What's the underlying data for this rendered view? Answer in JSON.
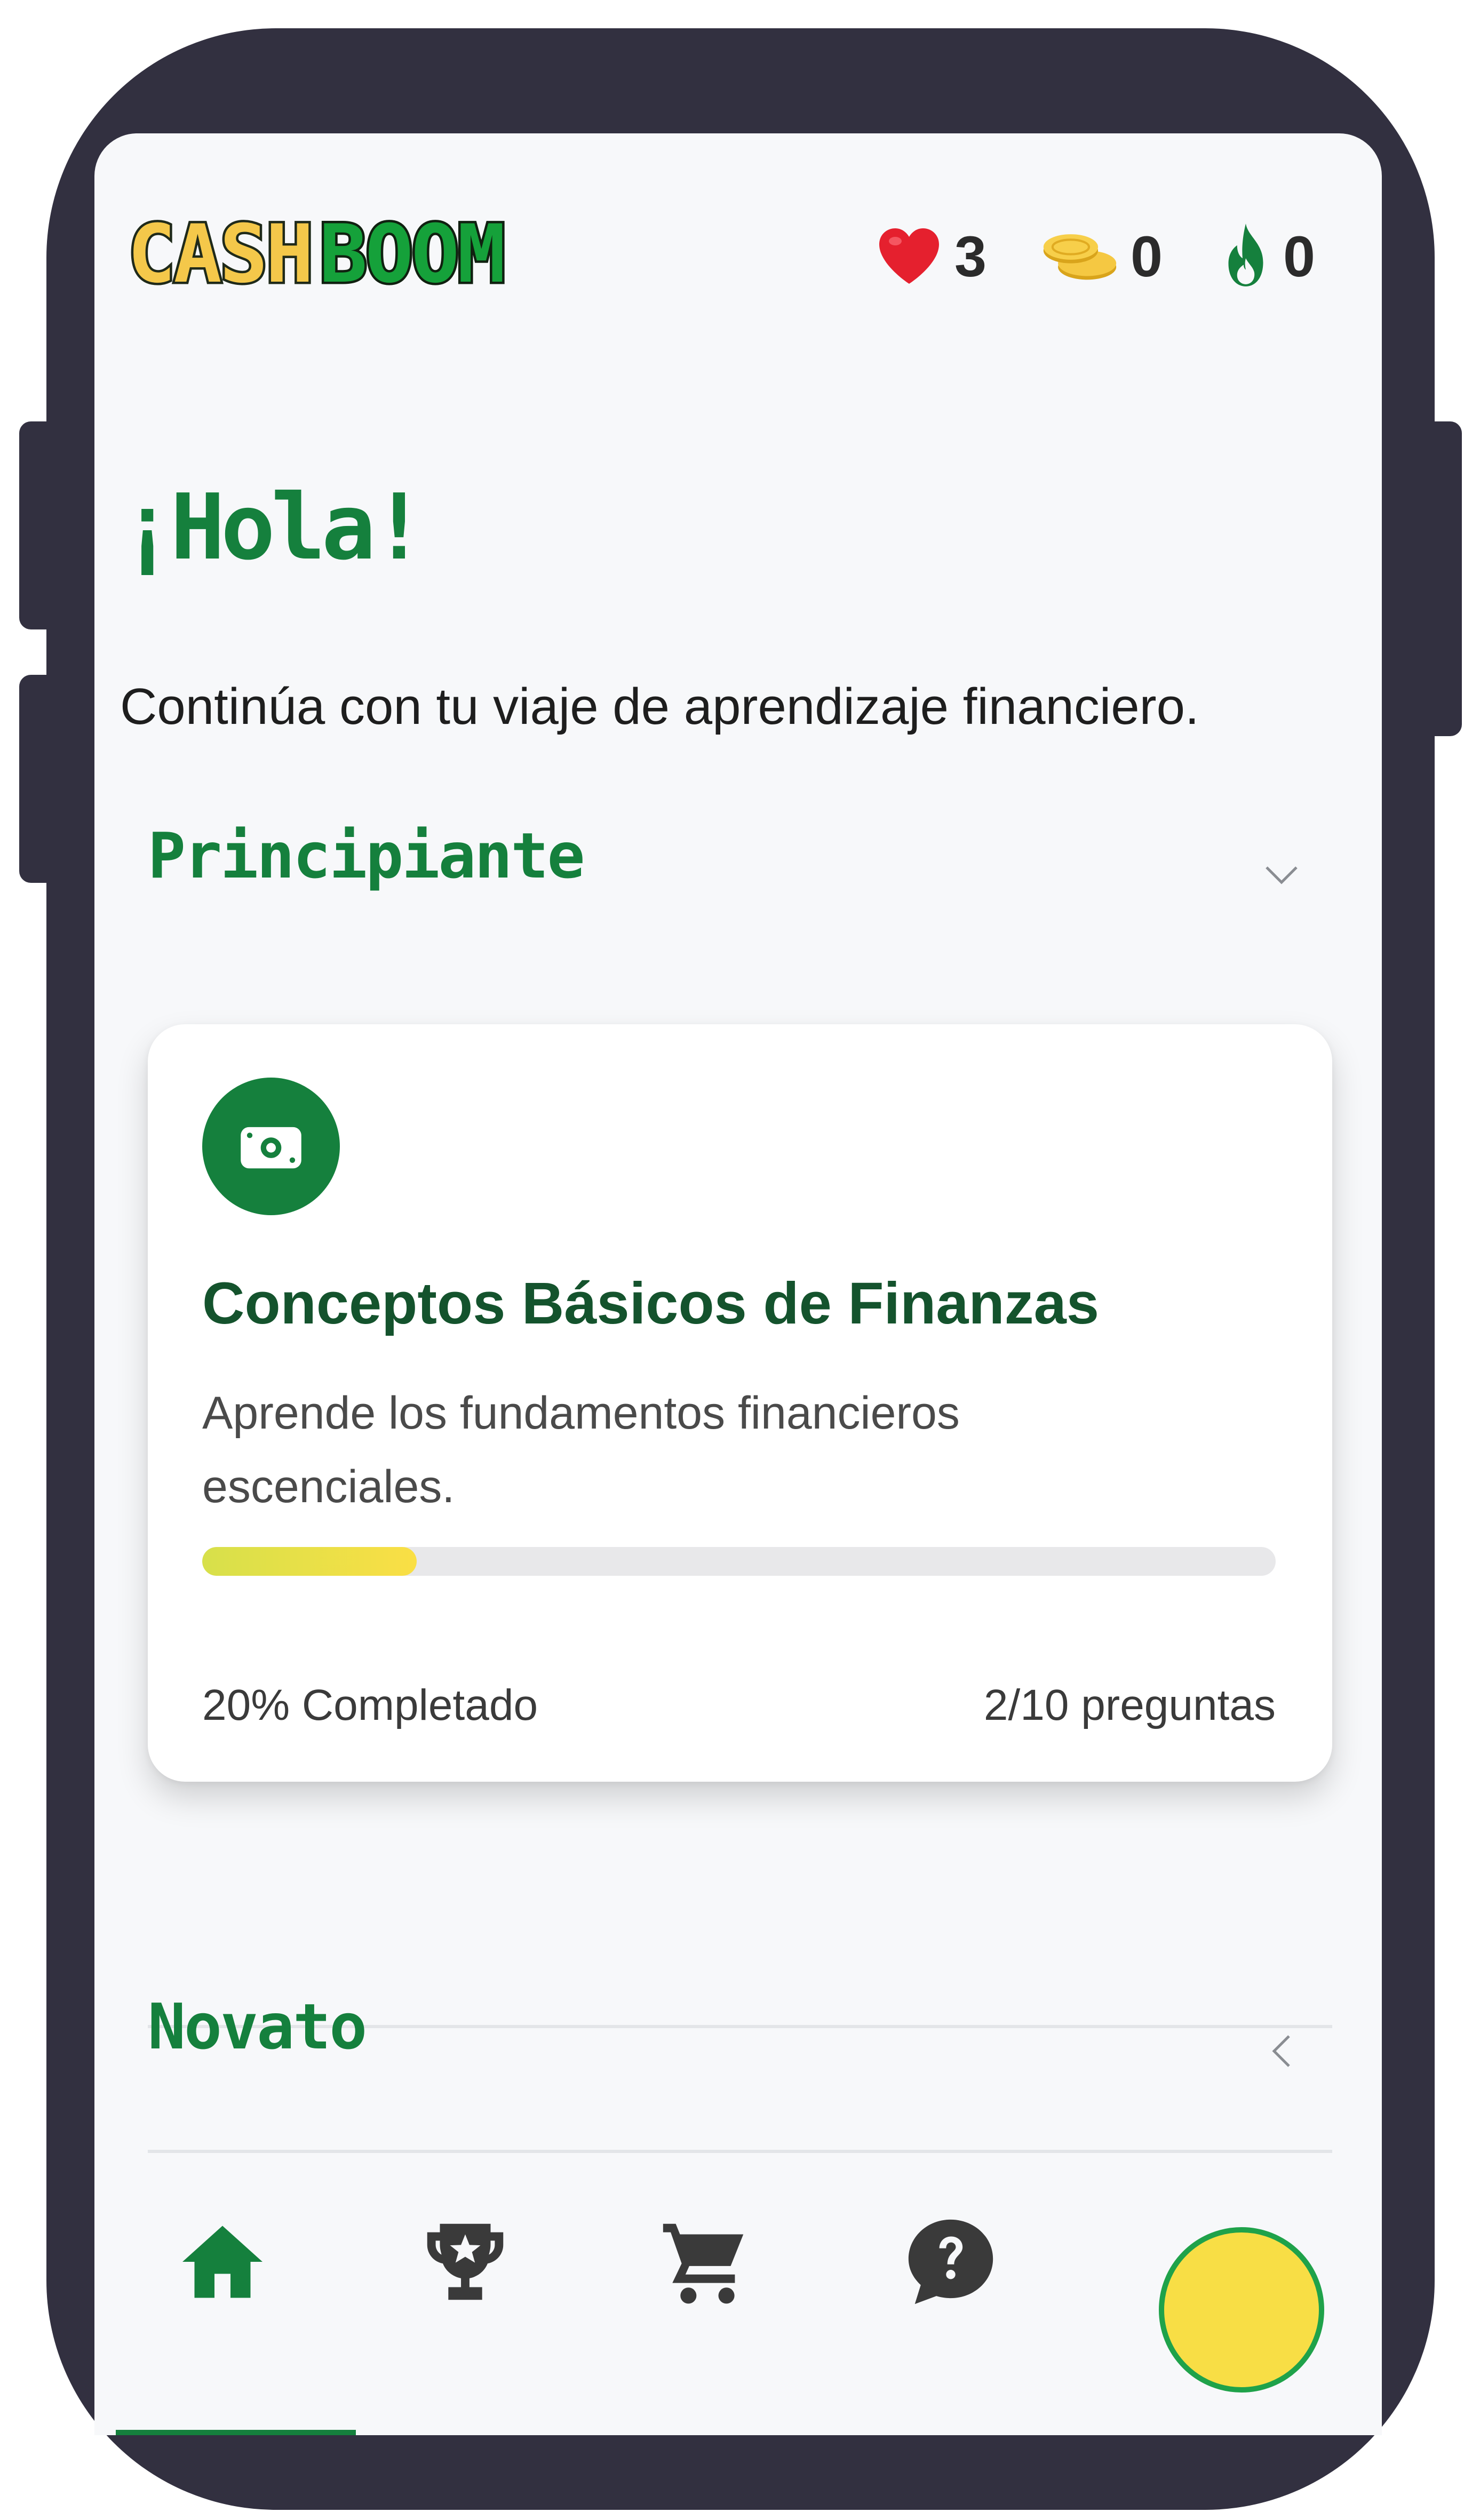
{
  "app": {
    "logo": {
      "part1": "CASH",
      "part2": "BOOM"
    }
  },
  "stats": {
    "hearts": "3",
    "coins": "0",
    "streak": "0"
  },
  "greeting": {
    "title": "¡Hola!",
    "subtitle": "Continúa con tu viaje de aprendizaje financiero."
  },
  "sections": [
    {
      "title": "Principiante",
      "expanded": true,
      "lessons": [
        {
          "icon": "money-icon",
          "title": "Conceptos Básicos de Finanzas",
          "description": "Aprende los fundamentos financieros escenciales.",
          "progress_fraction": 0.2,
          "progress_label": "20% Completado",
          "questions_label": "2/10 preguntas"
        }
      ]
    },
    {
      "title": "Novato",
      "expanded": false
    }
  ],
  "bottom_nav": {
    "items": [
      "home-icon",
      "trophy-icon",
      "cart-icon",
      "help-icon",
      "avatar"
    ],
    "active": "home-icon"
  },
  "colors": {
    "brand_green": "#15803d",
    "brand_yellow": "#fadf45",
    "frame": "#323040",
    "background": "#f7f8fa"
  }
}
